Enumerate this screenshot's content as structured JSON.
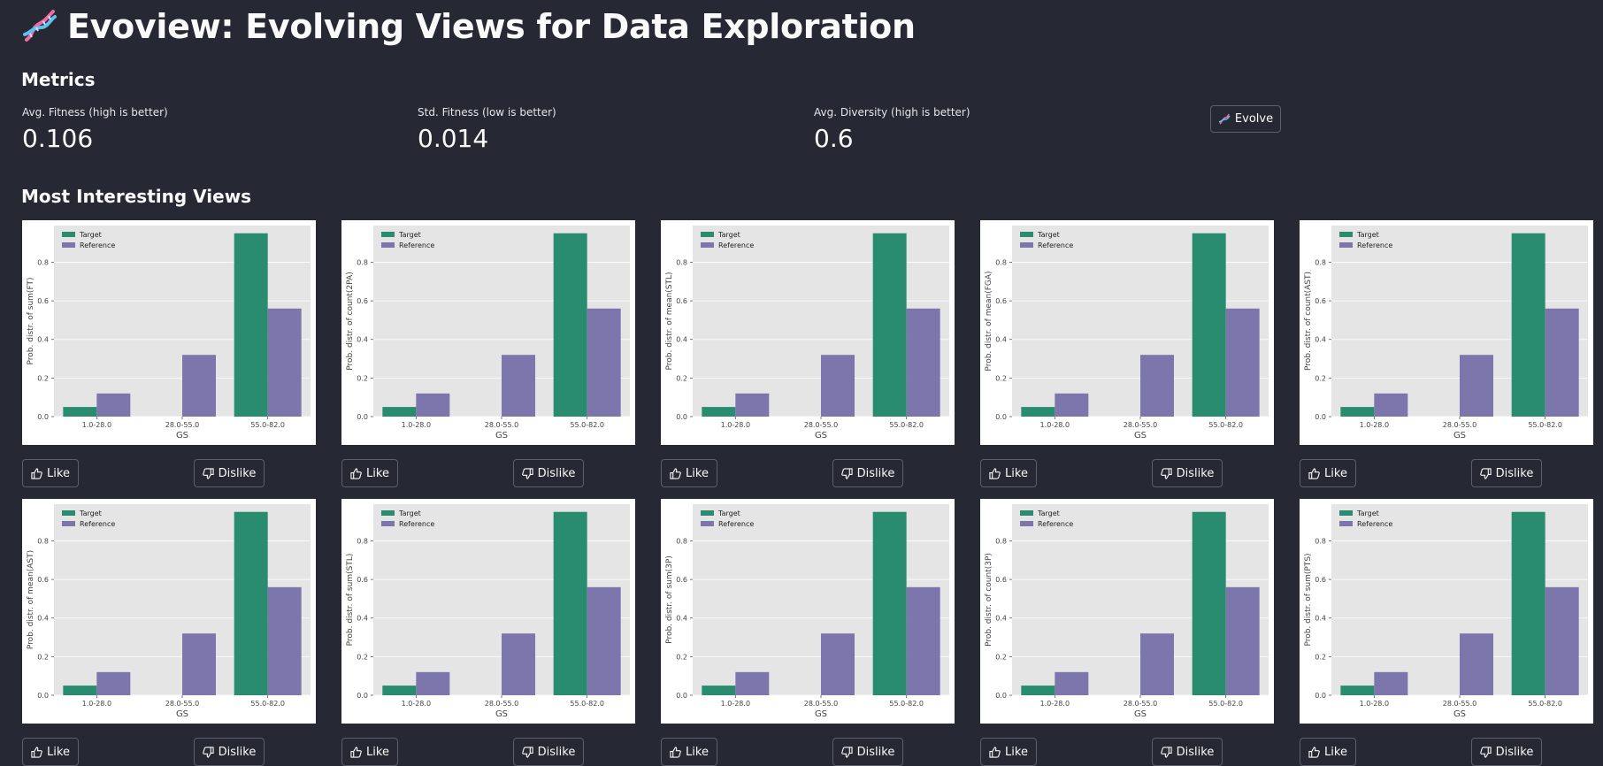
{
  "app": {
    "title": "Evoview: Evolving Views for Data Exploration"
  },
  "metrics": {
    "heading": "Metrics",
    "items": [
      {
        "label": "Avg. Fitness (high is better)",
        "value": "0.106"
      },
      {
        "label": "Std. Fitness (low is better)",
        "value": "0.014"
      },
      {
        "label": "Avg. Diversity (high is better)",
        "value": "0.6"
      }
    ],
    "evolve_label": "Evolve"
  },
  "views": {
    "heading": "Most Interesting Views",
    "like_label": "Like",
    "dislike_label": "Dislike"
  },
  "colors": {
    "background": "#262833",
    "target": "#2a8c6e",
    "reference": "#7d76ad",
    "plot_bg": "#e5e5e5"
  },
  "chart_data": [
    {
      "type": "bar",
      "xlabel": "GS",
      "ylabel": "Prob. distr. of sum(FT)",
      "categories": [
        "1.0-28.0",
        "28.0-55.0",
        "55.0-82.0"
      ],
      "series": [
        {
          "name": "Target",
          "values": [
            0.05,
            0.0,
            0.95
          ]
        },
        {
          "name": "Reference",
          "values": [
            0.12,
            0.32,
            0.56
          ]
        }
      ],
      "yticks": [
        "0.0",
        "0.2",
        "0.4",
        "0.6",
        "0.8"
      ],
      "ylim": [
        0,
        0.99
      ],
      "legend": "top-left",
      "grid": true
    },
    {
      "type": "bar",
      "xlabel": "GS",
      "ylabel": "Prob. distr. of count(2PA)",
      "categories": [
        "1.0-28.0",
        "28.0-55.0",
        "55.0-82.0"
      ],
      "series": [
        {
          "name": "Target",
          "values": [
            0.05,
            0.0,
            0.95
          ]
        },
        {
          "name": "Reference",
          "values": [
            0.12,
            0.32,
            0.56
          ]
        }
      ],
      "yticks": [
        "0.0",
        "0.2",
        "0.4",
        "0.6",
        "0.8"
      ],
      "ylim": [
        0,
        0.99
      ],
      "legend": "top-left",
      "grid": true
    },
    {
      "type": "bar",
      "xlabel": "GS",
      "ylabel": "Prob. distr. of mean(STL)",
      "categories": [
        "1.0-28.0",
        "28.0-55.0",
        "55.0-82.0"
      ],
      "series": [
        {
          "name": "Target",
          "values": [
            0.05,
            0.0,
            0.95
          ]
        },
        {
          "name": "Reference",
          "values": [
            0.12,
            0.32,
            0.56
          ]
        }
      ],
      "yticks": [
        "0.0",
        "0.2",
        "0.4",
        "0.6",
        "0.8"
      ],
      "ylim": [
        0,
        0.99
      ],
      "legend": "top-left",
      "grid": true
    },
    {
      "type": "bar",
      "xlabel": "GS",
      "ylabel": "Prob. distr. of mean(FGA)",
      "categories": [
        "1.0-28.0",
        "28.0-55.0",
        "55.0-82.0"
      ],
      "series": [
        {
          "name": "Target",
          "values": [
            0.05,
            0.0,
            0.95
          ]
        },
        {
          "name": "Reference",
          "values": [
            0.12,
            0.32,
            0.56
          ]
        }
      ],
      "yticks": [
        "0.0",
        "0.2",
        "0.4",
        "0.6",
        "0.8"
      ],
      "ylim": [
        0,
        0.99
      ],
      "legend": "top-left",
      "grid": true
    },
    {
      "type": "bar",
      "xlabel": "GS",
      "ylabel": "Prob. distr. of count(AST)",
      "categories": [
        "1.0-28.0",
        "28.0-55.0",
        "55.0-82.0"
      ],
      "series": [
        {
          "name": "Target",
          "values": [
            0.05,
            0.0,
            0.95
          ]
        },
        {
          "name": "Reference",
          "values": [
            0.12,
            0.32,
            0.56
          ]
        }
      ],
      "yticks": [
        "0.0",
        "0.2",
        "0.4",
        "0.6",
        "0.8"
      ],
      "ylim": [
        0,
        0.99
      ],
      "legend": "top-left",
      "grid": true
    },
    {
      "type": "bar",
      "xlabel": "GS",
      "ylabel": "Prob. distr. of mean(AST)",
      "categories": [
        "1.0-28.0",
        "28.0-55.0",
        "55.0-82.0"
      ],
      "series": [
        {
          "name": "Target",
          "values": [
            0.05,
            0.0,
            0.95
          ]
        },
        {
          "name": "Reference",
          "values": [
            0.12,
            0.32,
            0.56
          ]
        }
      ],
      "yticks": [
        "0.0",
        "0.2",
        "0.4",
        "0.6",
        "0.8"
      ],
      "ylim": [
        0,
        0.99
      ],
      "legend": "top-left",
      "grid": true
    },
    {
      "type": "bar",
      "xlabel": "GS",
      "ylabel": "Prob. distr. of sum(STL)",
      "categories": [
        "1.0-28.0",
        "28.0-55.0",
        "55.0-82.0"
      ],
      "series": [
        {
          "name": "Target",
          "values": [
            0.05,
            0.0,
            0.95
          ]
        },
        {
          "name": "Reference",
          "values": [
            0.12,
            0.32,
            0.56
          ]
        }
      ],
      "yticks": [
        "0.0",
        "0.2",
        "0.4",
        "0.6",
        "0.8"
      ],
      "ylim": [
        0,
        0.99
      ],
      "legend": "top-left",
      "grid": true
    },
    {
      "type": "bar",
      "xlabel": "GS",
      "ylabel": "Prob. distr. of sum(3P)",
      "categories": [
        "1.0-28.0",
        "28.0-55.0",
        "55.0-82.0"
      ],
      "series": [
        {
          "name": "Target",
          "values": [
            0.05,
            0.0,
            0.95
          ]
        },
        {
          "name": "Reference",
          "values": [
            0.12,
            0.32,
            0.56
          ]
        }
      ],
      "yticks": [
        "0.0",
        "0.2",
        "0.4",
        "0.6",
        "0.8"
      ],
      "ylim": [
        0,
        0.99
      ],
      "legend": "top-left",
      "grid": true
    },
    {
      "type": "bar",
      "xlabel": "GS",
      "ylabel": "Prob. distr. of count(3P)",
      "categories": [
        "1.0-28.0",
        "28.0-55.0",
        "55.0-82.0"
      ],
      "series": [
        {
          "name": "Target",
          "values": [
            0.05,
            0.0,
            0.95
          ]
        },
        {
          "name": "Reference",
          "values": [
            0.12,
            0.32,
            0.56
          ]
        }
      ],
      "yticks": [
        "0.0",
        "0.2",
        "0.4",
        "0.6",
        "0.8"
      ],
      "ylim": [
        0,
        0.99
      ],
      "legend": "top-left",
      "grid": true
    },
    {
      "type": "bar",
      "xlabel": "GS",
      "ylabel": "Prob. distr. of sum(PTS)",
      "categories": [
        "1.0-28.0",
        "28.0-55.0",
        "55.0-82.0"
      ],
      "series": [
        {
          "name": "Target",
          "values": [
            0.05,
            0.0,
            0.95
          ]
        },
        {
          "name": "Reference",
          "values": [
            0.12,
            0.32,
            0.56
          ]
        }
      ],
      "yticks": [
        "0.0",
        "0.2",
        "0.4",
        "0.6",
        "0.8"
      ],
      "ylim": [
        0,
        0.99
      ],
      "legend": "top-left",
      "grid": true
    }
  ]
}
